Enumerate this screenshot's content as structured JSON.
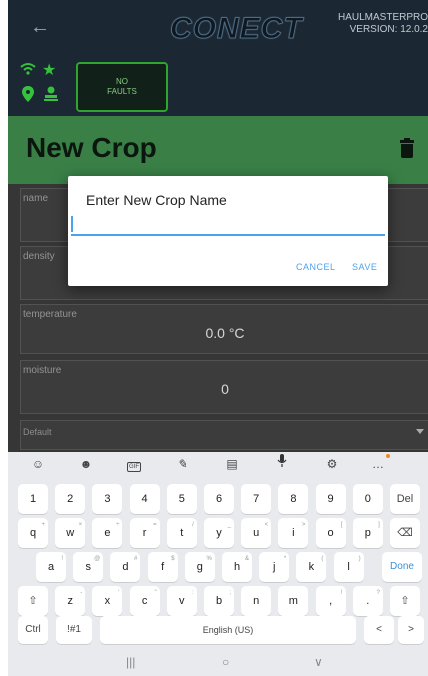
{
  "header": {
    "back_icon": "arrow-left-icon",
    "logo_co": "CO",
    "logo_nect": "NECT",
    "version_line1": "HAULMASTERPRO",
    "version_line2": "VERSION: 12.0.2"
  },
  "status": {
    "icons": [
      "wifi-icon",
      "star-icon",
      "location-pin-icon",
      "person-icon"
    ],
    "faults_line1": "NO",
    "faults_line2": "FAULTS",
    "accent": "#35c23c"
  },
  "page": {
    "title": "New Crop",
    "delete_icon": "trash-icon"
  },
  "form": {
    "fields": [
      {
        "label": "name",
        "value": ""
      },
      {
        "label": "density",
        "value": ""
      },
      {
        "label": "temperature",
        "value": "0.0 °C"
      },
      {
        "label": "moisture",
        "value": "0"
      }
    ],
    "select_value": "Default"
  },
  "dialog": {
    "title": "Enter New Crop Name",
    "input_value": "",
    "cancel_label": "CANCEL",
    "save_label": "SAVE",
    "accent": "#4aa3f0"
  },
  "keyboard": {
    "toolbar_icons": [
      "emoji-icon",
      "sticker-icon",
      "gif-icon",
      "handwriting-icon",
      "clipboard-icon",
      "mic-icon",
      "settings-icon",
      "more-icon"
    ],
    "gif_label": "GIF",
    "row1": [
      "1",
      "2",
      "3",
      "4",
      "5",
      "6",
      "7",
      "8",
      "9",
      "0",
      "Del"
    ],
    "row2": [
      "q",
      "w",
      "e",
      "r",
      "t",
      "y",
      "u",
      "i",
      "o",
      "p",
      "⌫"
    ],
    "row2_sup": [
      "+",
      "×",
      "÷",
      "=",
      "/",
      "_",
      "<",
      ">",
      "[",
      "]",
      ""
    ],
    "row3": [
      "a",
      "s",
      "d",
      "f",
      "g",
      "h",
      "j",
      "k",
      "l",
      "Done"
    ],
    "row3_sup": [
      "!",
      "@",
      "#",
      "$",
      "%",
      "&",
      "*",
      "(",
      ")",
      ""
    ],
    "row4": [
      "⇧",
      "z",
      "x",
      "c",
      "v",
      "b",
      "n",
      "m",
      ",",
      ".",
      "⇧"
    ],
    "row4_sup": [
      "",
      "-",
      "'",
      "\"",
      ":",
      ";",
      "",
      "",
      "!",
      "?",
      ""
    ],
    "row5_ctrl": "Ctrl",
    "row5_sym": "!#1",
    "space_label": "English (US)",
    "left_arrow": "<",
    "right_arrow": ">"
  },
  "navbar": {
    "recents": "|||",
    "home": "○",
    "back": "∨"
  }
}
